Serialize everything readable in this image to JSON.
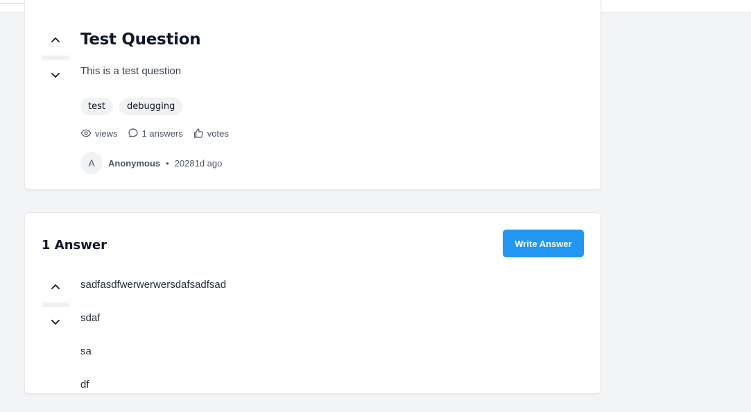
{
  "topbar": {
    "search_placeholder": "",
    "accent": "#2196f3"
  },
  "question": {
    "title": "Test Question",
    "body": "This is a test question",
    "tags": [
      "test",
      "debugging"
    ],
    "stats": {
      "views_label": "views",
      "answers_label": "1 answers",
      "votes_label": "votes"
    },
    "author": {
      "avatar_initial": "A",
      "name": "Anonymous",
      "separator": "•",
      "time": "20281d ago"
    },
    "icons": {
      "upvote": "chevron-up-icon",
      "downvote": "chevron-down-icon",
      "views": "eye-icon",
      "answers": "comment-icon",
      "votes": "thumbs-up-icon"
    }
  },
  "answers": {
    "heading": "1 Answer",
    "write_button": "Write Answer",
    "items": [
      {
        "lines": [
          "sadfasdfwerwerwersdafsadfsad",
          "sdaf",
          "sa",
          "df"
        ]
      }
    ]
  },
  "colors": {
    "primary": "#2196f3",
    "page_bg": "#f3f4f6",
    "card_bg": "#ffffff",
    "tag_bg": "#f1f2f4"
  }
}
